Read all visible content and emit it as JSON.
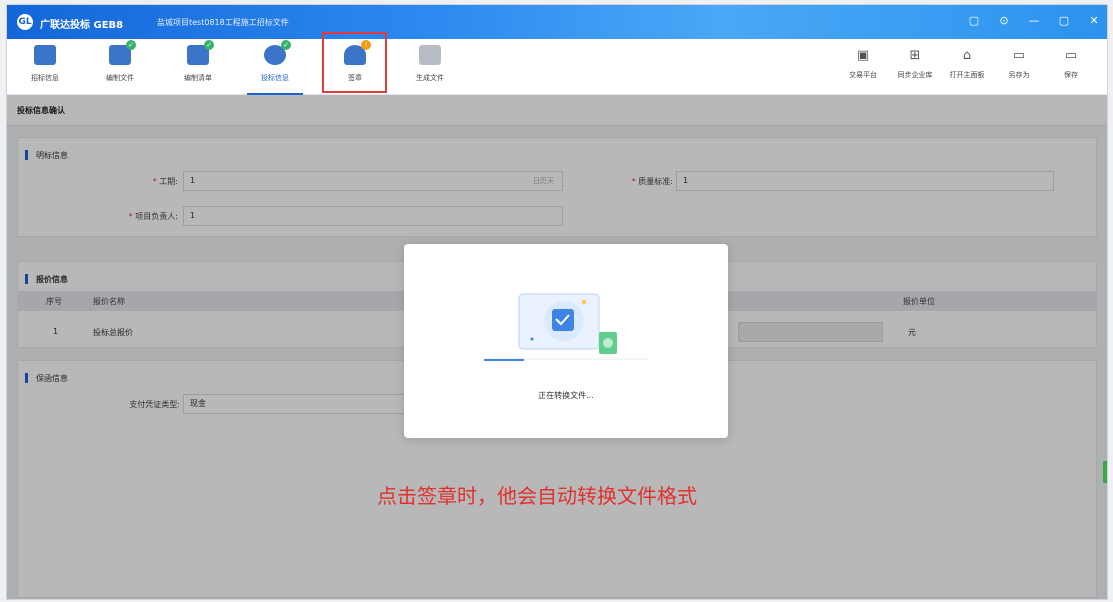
{
  "window": {
    "app_title": "广联达投标 GEB8",
    "doc_title": "盐城项目test0818工程施工招标文件",
    "buttons": [
      "▢",
      "⊙",
      "—",
      "▢",
      "✕"
    ]
  },
  "toolbar": {
    "items": [
      {
        "label": "招标信息",
        "icon": "document-icon",
        "color": "#3b74c9"
      },
      {
        "label": "编制文件",
        "icon": "edit-file-icon",
        "color": "#3b74c9",
        "badge": "✓"
      },
      {
        "label": "编制清单",
        "icon": "edit-list-icon",
        "color": "#3b74c9",
        "badge": "✓"
      },
      {
        "label": "投标信息",
        "icon": "target-icon",
        "color": "#3b74c9",
        "badge": "✓",
        "active": true
      },
      {
        "label": "签章",
        "icon": "seal-icon",
        "color": "#3b74c9",
        "badge": "!"
      },
      {
        "label": "生成文件",
        "icon": "generate-file-icon",
        "color": "#b8bcc4"
      }
    ],
    "right": [
      {
        "label": "交易平台",
        "icon": "platform-icon"
      },
      {
        "label": "同步企业库",
        "icon": "sync-icon"
      },
      {
        "label": "打开主面板",
        "icon": "home-icon"
      },
      {
        "label": "另存为",
        "icon": "save-as-icon"
      },
      {
        "label": "保存",
        "icon": "save-icon"
      }
    ]
  },
  "page": {
    "title": "投标信息确认"
  },
  "bid_info": {
    "title": "明标信息",
    "duration_label": "工期:",
    "duration_value": "1",
    "duration_unit": "日历天",
    "quality_label": "质量标准:",
    "quality_value": "1",
    "manager_label": "项目负责人:",
    "manager_value": "1"
  },
  "quote_info": {
    "title": "报价信息",
    "headers": [
      "序号",
      "报价名称",
      "报价单位"
    ],
    "rows": [
      {
        "no": "1",
        "name": "投标总报价",
        "unit": "元"
      }
    ]
  },
  "guarantee": {
    "title": "保函信息",
    "pay_label": "支付凭证类型:",
    "pay_value": "现金"
  },
  "modal": {
    "message": "正在转换文件..."
  },
  "annotation": "点击签章时，他会自动转换文件格式",
  "colors": {
    "accent": "#1d63d8",
    "annotation": "#e0312e",
    "highlight_box": "#e33b3b"
  }
}
